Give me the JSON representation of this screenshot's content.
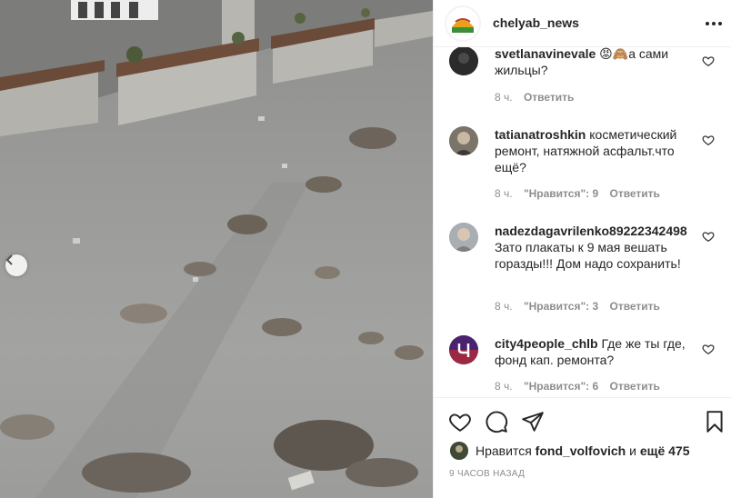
{
  "post": {
    "author": "chelyab_news",
    "photo_description_icon": "photo-asphalt-icon"
  },
  "comments": [
    {
      "username": "svetlanavinevale",
      "text": " 😡🙈а сами жильцы?",
      "time": "8 ч.",
      "likes": "",
      "reply": "Ответить"
    },
    {
      "username": "tatianatroshkin",
      "text": " косметический ремонт, натяжной асфальт.что ещё?",
      "time": "8 ч.",
      "likes": "\"Нравится\": 9",
      "reply": "Ответить"
    },
    {
      "username": "nadezdagavrilenko89222342498",
      "text": " Зато плакаты к 9 мая вешать горазды!!! Дом надо сохранить!",
      "time": "8 ч.",
      "likes": "\"Нравится\": 3",
      "reply": "Ответить"
    },
    {
      "username": "city4people_chlb",
      "text": " Где же ты где, фонд кап. ремонта?",
      "time": "8 ч.",
      "likes": "\"Нравится\": 6",
      "reply": "Ответить"
    }
  ],
  "likes_line": {
    "prefix": "Нравится ",
    "user": "fond_volfovich",
    "middle": " и ",
    "rest": "ещё 475"
  },
  "timestamp": "9 ЧАСОВ НАЗАД",
  "colors": {
    "text": "#262626",
    "muted": "#8e8e8e",
    "border": "#efefef"
  }
}
